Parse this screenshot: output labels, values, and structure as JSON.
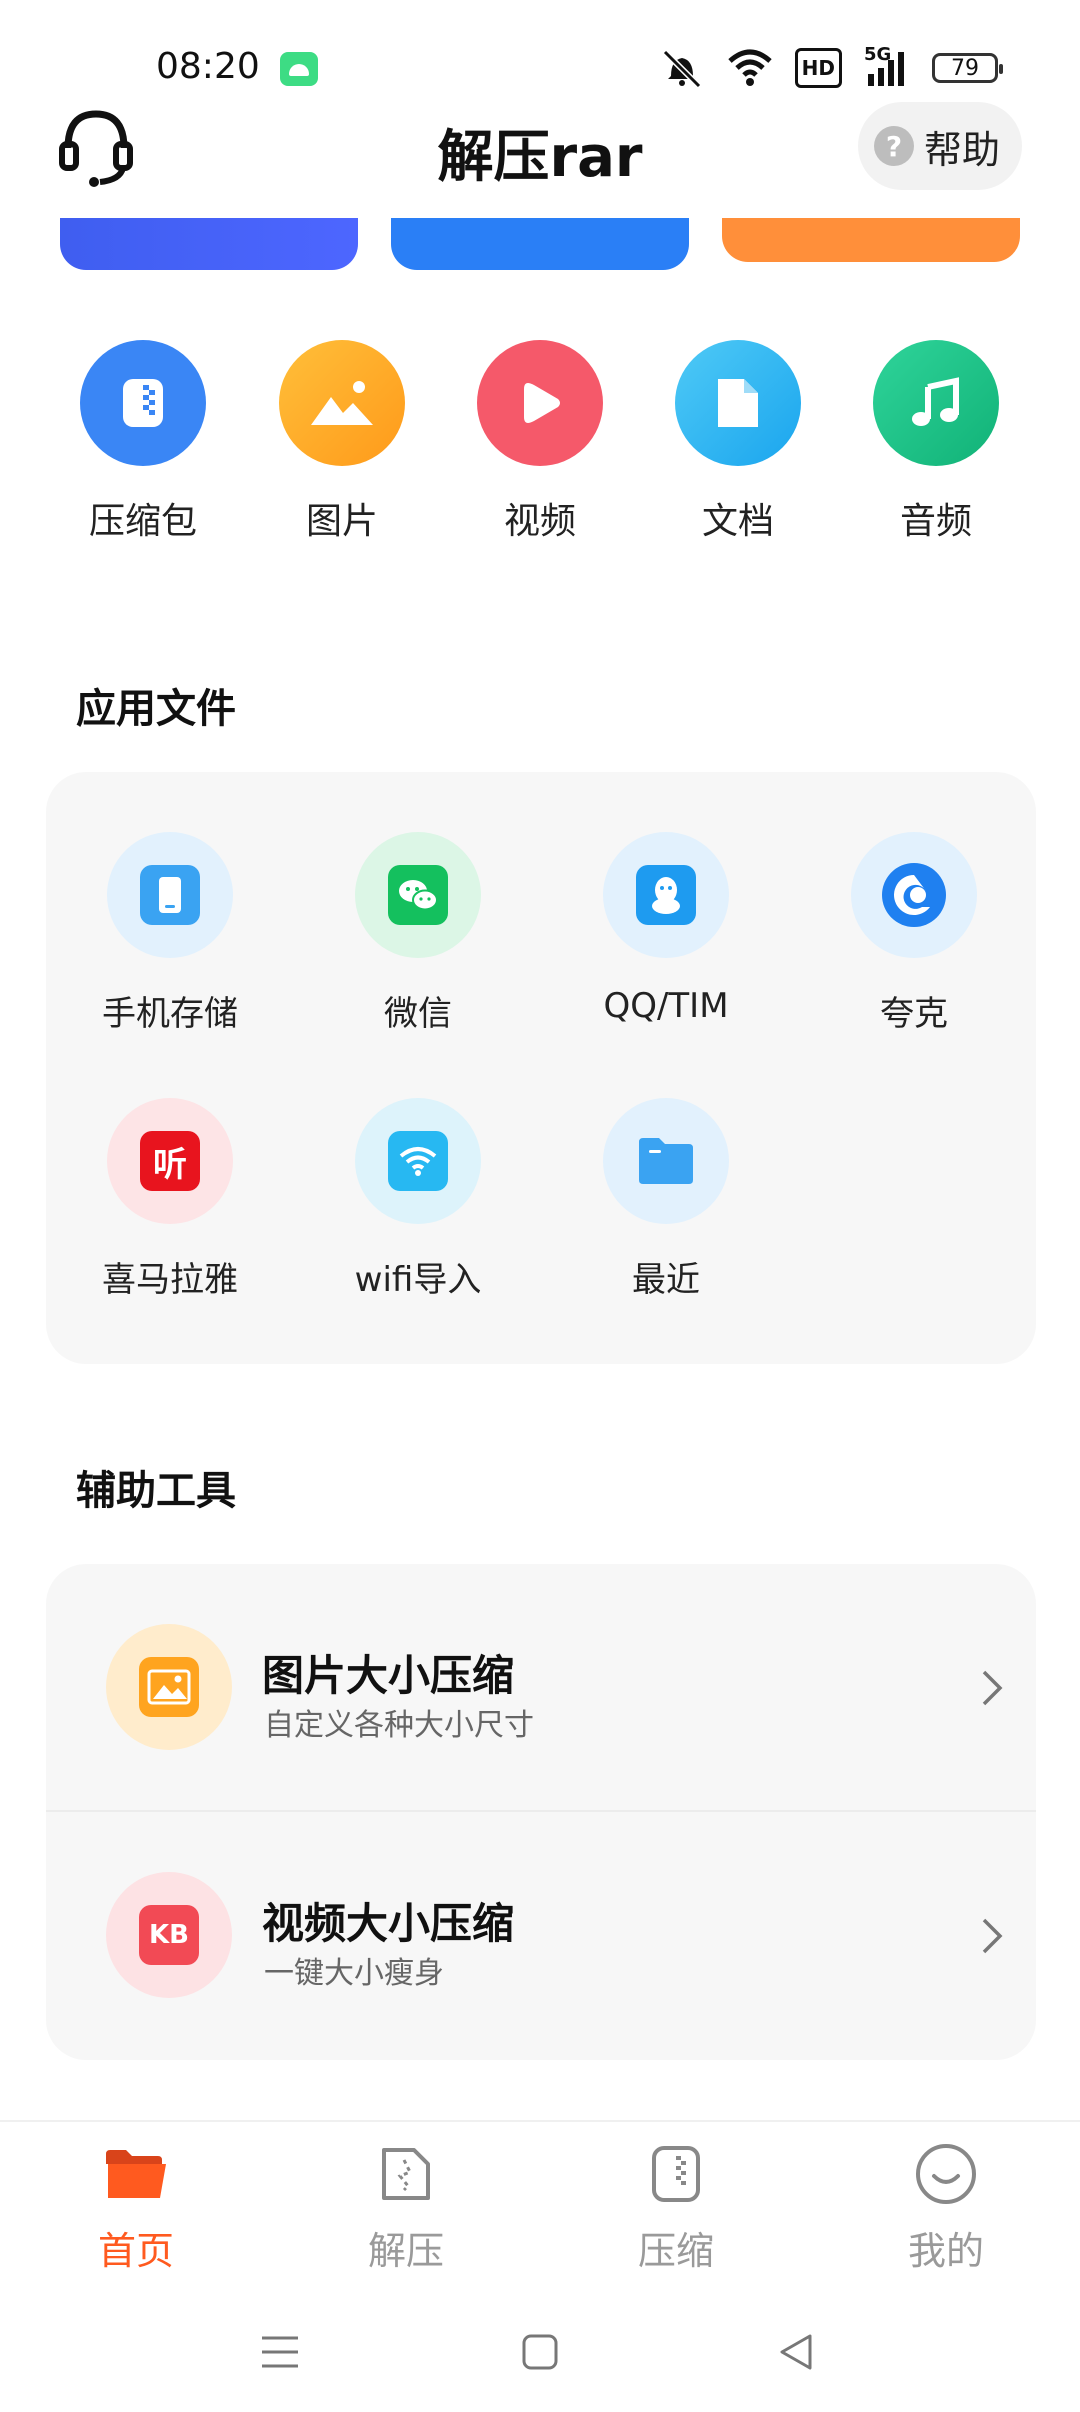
{
  "status_bar": {
    "time": "08:20",
    "battery": "79",
    "network": "5G",
    "hd": "HD"
  },
  "header": {
    "title": "解压rar",
    "help_label": "帮助"
  },
  "categories": [
    {
      "label": "压缩包",
      "color": "#3a86f5",
      "icon": "zip-icon"
    },
    {
      "label": "图片",
      "color": "#ffa224",
      "icon": "image-icon"
    },
    {
      "label": "视频",
      "color": "#f5596a",
      "icon": "play-icon"
    },
    {
      "label": "文档",
      "color": "#2bb6f3",
      "icon": "document-icon"
    },
    {
      "label": "音频",
      "color": "#1fc58b",
      "icon": "music-icon"
    }
  ],
  "app_files": {
    "title": "应用文件",
    "items": [
      {
        "label": "手机存储",
        "icon": "phone-storage-icon"
      },
      {
        "label": "微信",
        "icon": "wechat-icon"
      },
      {
        "label": "QQ/TIM",
        "icon": "qq-icon"
      },
      {
        "label": "夸克",
        "icon": "quark-icon"
      },
      {
        "label": "喜马拉雅",
        "icon": "ximalaya-icon",
        "badge": "听"
      },
      {
        "label": "wifi导入",
        "icon": "wifi-icon"
      },
      {
        "label": "最近",
        "icon": "folder-icon"
      }
    ]
  },
  "tools": {
    "title": "辅助工具",
    "items": [
      {
        "title": "图片大小压缩",
        "subtitle": "自定义各种大小尺寸",
        "icon": "image-compress-icon"
      },
      {
        "title": "视频大小压缩",
        "subtitle": "一键大小瘦身",
        "icon": "video-compress-icon",
        "badge": "KB"
      }
    ]
  },
  "bottom_nav": [
    {
      "label": "首页",
      "active": true,
      "icon": "home-folder-icon"
    },
    {
      "label": "解压",
      "active": false,
      "icon": "unzip-icon"
    },
    {
      "label": "压缩",
      "active": false,
      "icon": "compress-icon"
    },
    {
      "label": "我的",
      "active": false,
      "icon": "profile-icon"
    }
  ],
  "colors": {
    "accent": "#ff5a1f"
  }
}
